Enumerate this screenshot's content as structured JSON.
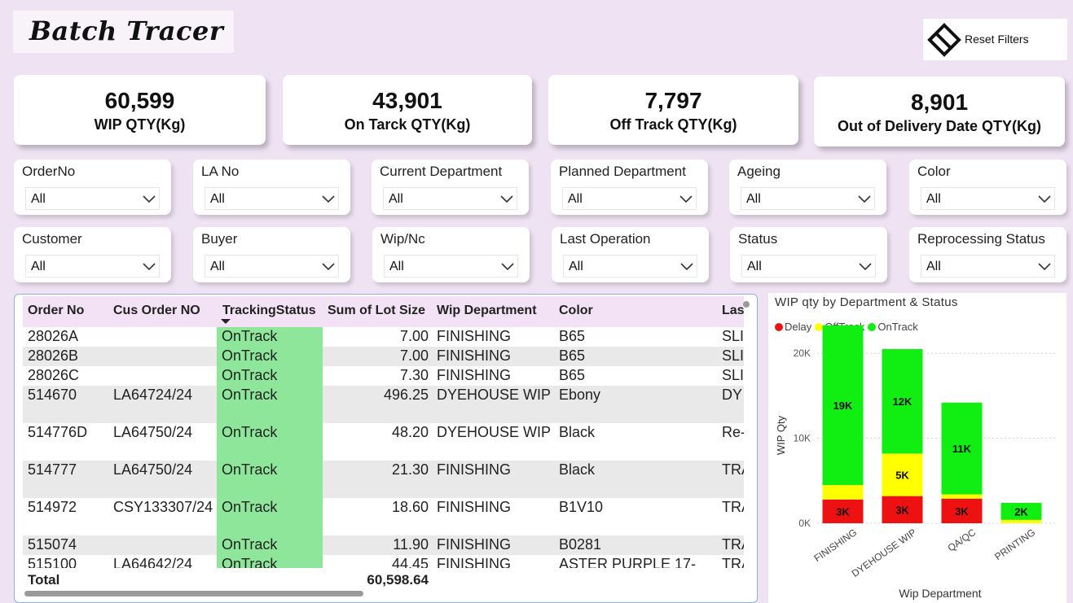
{
  "header": {
    "title": "Batch Tracer"
  },
  "reset": {
    "label": "Reset Filters",
    "icon": "eraser-icon"
  },
  "kpis": [
    {
      "value": "60,599",
      "label": "WIP QTY(Kg)"
    },
    {
      "value": "43,901",
      "label": "On Tarck QTY(Kg)"
    },
    {
      "value": "7,797",
      "label": "Off Track QTY(Kg)"
    },
    {
      "value": "8,901",
      "label": "Out of Delivery Date  QTY(Kg)"
    }
  ],
  "slicers": [
    {
      "title": "OrderNo",
      "value": "All"
    },
    {
      "title": "LA No",
      "value": "All"
    },
    {
      "title": "Current Department",
      "value": "All"
    },
    {
      "title": "Planned Department",
      "value": "All"
    },
    {
      "title": "Ageing",
      "value": "All"
    },
    {
      "title": "Color",
      "value": "All"
    },
    {
      "title": "Customer",
      "value": "All"
    },
    {
      "title": "Buyer",
      "value": "All"
    },
    {
      "title": "Wip/Nc",
      "value": "All"
    },
    {
      "title": "Last Operation",
      "value": "All"
    },
    {
      "title": "Status",
      "value": "All"
    },
    {
      "title": "Reprocessing Status",
      "value": "All"
    }
  ],
  "table": {
    "headers": [
      "Order No",
      "Cus Order NO",
      "TrackingStatus",
      "Sum of Lot Size",
      "Wip Department",
      "Color",
      "Las"
    ],
    "rows": [
      [
        "28026A",
        "",
        "OnTrack",
        "7.00",
        "FINISHING",
        "B65",
        "SLI"
      ],
      [
        "28026B",
        "",
        "OnTrack",
        "7.00",
        "FINISHING",
        "B65",
        "SLI"
      ],
      [
        "28026C",
        "",
        "OnTrack",
        "7.30",
        "FINISHING",
        "B65",
        "SLI"
      ],
      [
        "514670",
        "LA64724/24",
        "OnTrack",
        "496.25",
        "DYEHOUSE WIP",
        "Ebony",
        "DY"
      ],
      [
        "514776D",
        "LA64750/24",
        "OnTrack",
        "48.20",
        "DYEHOUSE WIP",
        "Black",
        "Re-"
      ],
      [
        "514777",
        "LA64750/24",
        "OnTrack",
        "21.30",
        "FINISHING",
        "Black",
        "TRA"
      ],
      [
        "514972",
        "CSY133307/24",
        "OnTrack",
        "18.60",
        "FINISHING",
        "B1V10",
        "TRA"
      ],
      [
        "515074",
        "",
        "OnTrack",
        "11.90",
        "FINISHING",
        "B0281",
        "TRA"
      ],
      [
        "515100",
        "LA64642/24",
        "OnTrack",
        "44.45",
        "FINISHING",
        "ASTER PURPLE 17-",
        "TRA"
      ]
    ],
    "total_label": "Total",
    "total_value": "60,598.64"
  },
  "chart_data": {
    "type": "bar",
    "stacked": true,
    "title": "WIP qty by Department & Status",
    "xlabel": "Wip Department",
    "ylabel": "WIP Qty",
    "categories": [
      "FINISHING",
      "DYEHOUSE WIP",
      "QA/QC",
      "PRINTING"
    ],
    "series": [
      {
        "name": "Delay",
        "color": "#ee1111",
        "values": [
          2800,
          3200,
          2900,
          0
        ],
        "labels": [
          "3K",
          "3K",
          "3K",
          ""
        ]
      },
      {
        "name": "OffTrack",
        "color": "#ffff00",
        "values": [
          1700,
          5000,
          500,
          400
        ],
        "labels": [
          "",
          "5K",
          "",
          ""
        ]
      },
      {
        "name": "OnTrack",
        "color": "#11ee11",
        "values": [
          18800,
          12300,
          10800,
          2000
        ],
        "labels": [
          "19K",
          "12K",
          "11K",
          "2K"
        ]
      }
    ],
    "ylim": [
      0,
      25000
    ],
    "yticks": [
      0,
      10000,
      20000
    ],
    "ytick_labels": [
      "0K",
      "10K",
      "20K"
    ],
    "legend": "top-left",
    "grid": true
  }
}
